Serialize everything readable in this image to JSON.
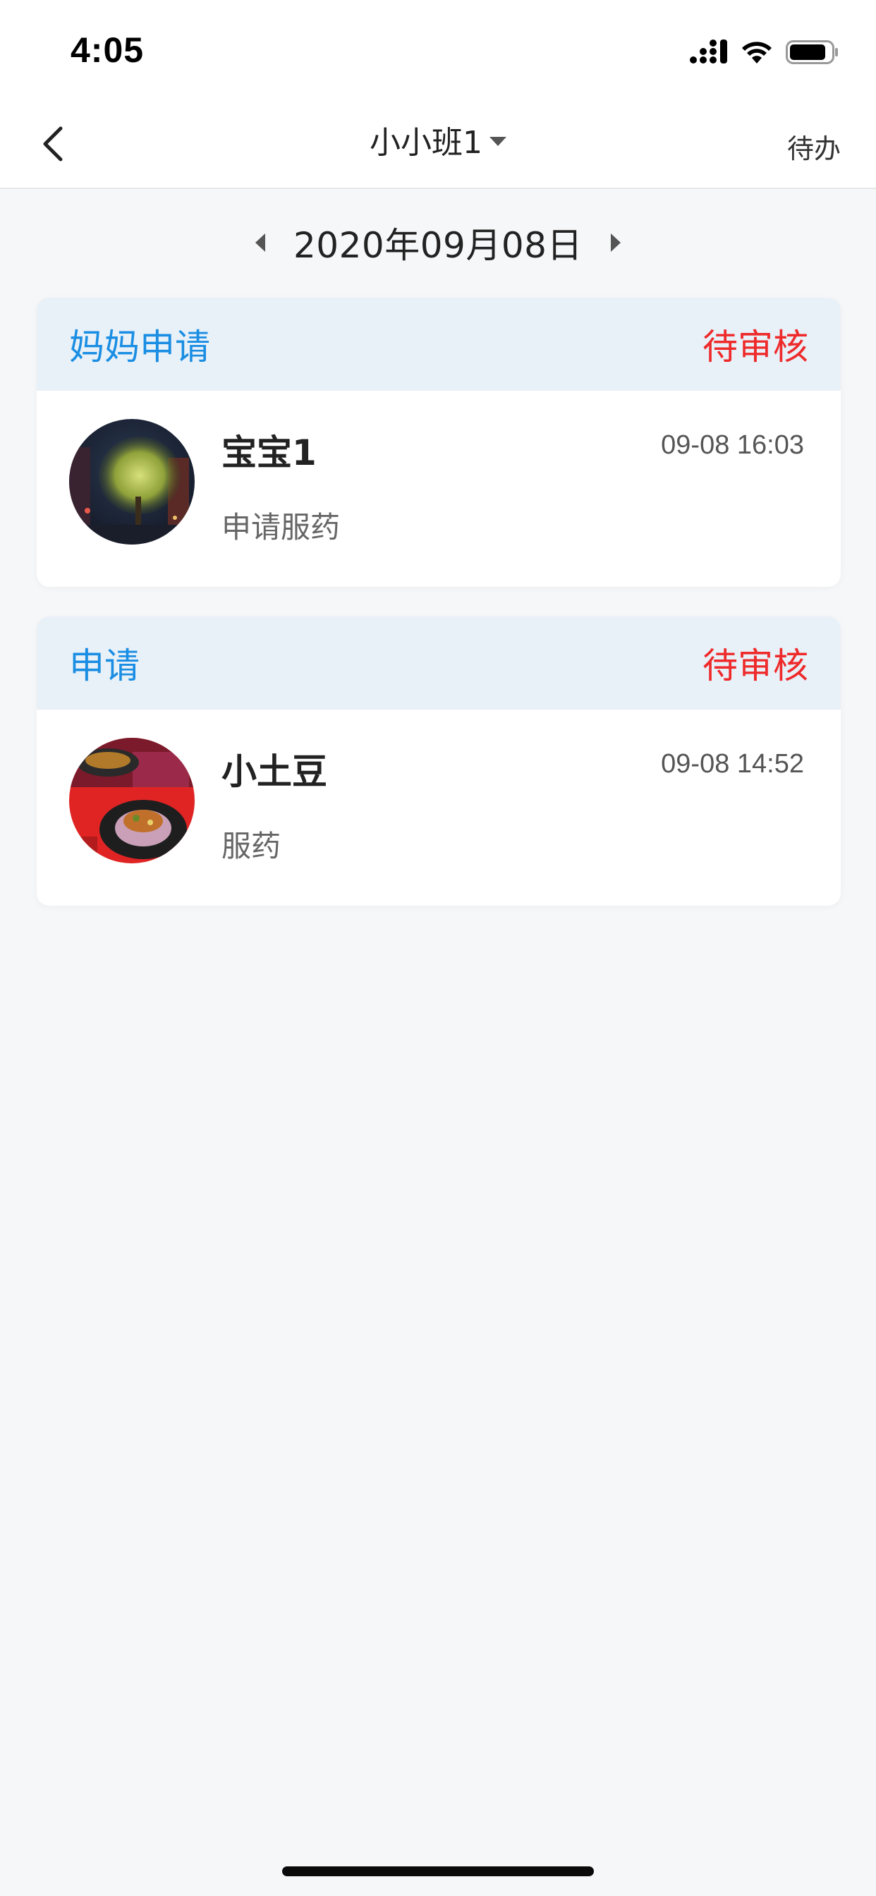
{
  "status_bar": {
    "time": "4:05",
    "icons": [
      "cellular-signal-icon",
      "wifi-icon",
      "battery-icon"
    ]
  },
  "nav": {
    "back_icon": "chevron-left-icon",
    "title": "小小班1",
    "title_dropdown_icon": "caret-down-icon",
    "right_action": "待办"
  },
  "date_switcher": {
    "prev_icon": "triangle-left-icon",
    "date": "2020年09月08日",
    "next_icon": "triangle-right-icon"
  },
  "cards": [
    {
      "type": "妈妈申请",
      "status": "待审核",
      "name": "宝宝1",
      "time": "09-08 16:03",
      "description": "申请服药",
      "avatar": "avatar-night-tree"
    },
    {
      "type": "申请",
      "status": "待审核",
      "name": "小土豆",
      "time": "09-08 14:52",
      "description": "服药",
      "avatar": "avatar-food"
    }
  ],
  "colors": {
    "accent_blue": "#1a8ee3",
    "status_red": "#ee2a2a",
    "card_header_bg": "#e8f0f8",
    "page_bg": "#f6f7f8"
  }
}
